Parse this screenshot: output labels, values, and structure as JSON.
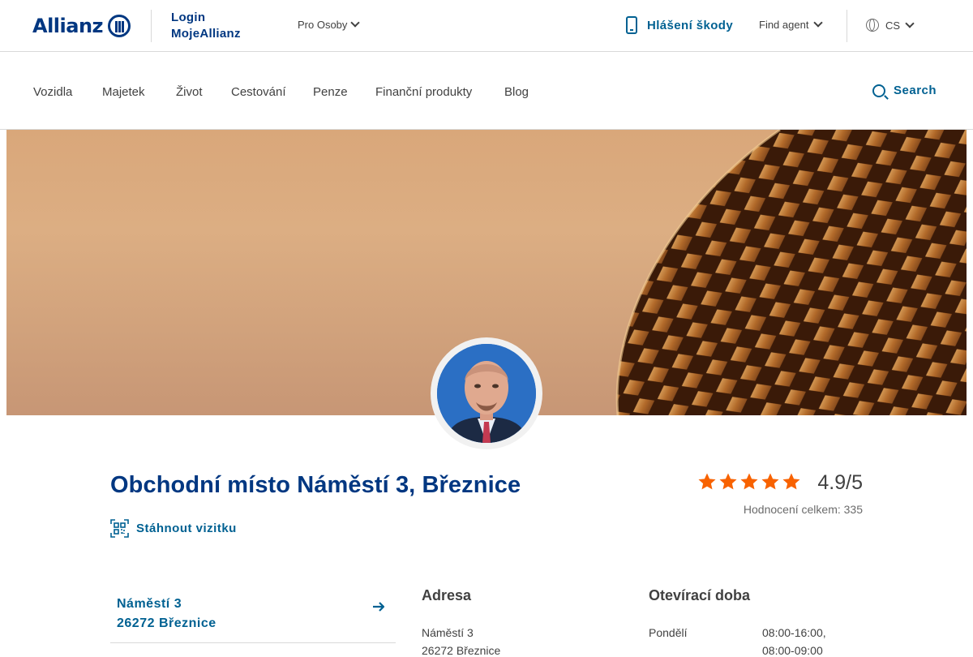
{
  "header": {
    "logo_text": "Allianz",
    "login_line1": "Login",
    "login_line2": "MojeAllianz",
    "audience_label": "Pro Osoby",
    "claims_label": "Hlášení škody",
    "find_agent_label": "Find agent",
    "language_label": "CS"
  },
  "nav": {
    "items": [
      "Vozidla",
      "Majetek",
      "Život",
      "Cestování",
      "Penze",
      "Finanční produkty",
      "Blog"
    ],
    "search_label": "Search"
  },
  "profile": {
    "title": "Obchodní místo Náměstí 3, Březnice",
    "vcard_label": "Stáhnout vizitku",
    "rating": {
      "stars": 5,
      "score_text": "4.9/5",
      "count_text": "Hodnocení celkem: 335"
    }
  },
  "address_card": {
    "line1": "Náměstí 3",
    "line2": "26272 Březnice"
  },
  "address_section": {
    "heading": "Adresa",
    "line1": "Náměstí 3",
    "line2": "26272 Březnice"
  },
  "hours_section": {
    "heading": "Otevírací doba",
    "rows": [
      {
        "day": "Pondělí",
        "time1": "08:00-16:00,",
        "time2": "08:00-09:00"
      }
    ]
  },
  "colors": {
    "brand": "#003781",
    "accent": "#006192",
    "star": "#f86200"
  }
}
